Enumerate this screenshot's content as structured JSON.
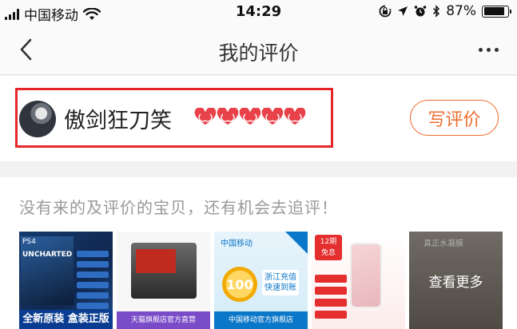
{
  "status_bar": {
    "carrier": "中国移动",
    "time": "14:29",
    "battery_percent": "87%",
    "battery_level": 0.87,
    "icons": [
      "signal-icon",
      "wifi-icon",
      "screen-lock-icon",
      "location-icon",
      "alarm-icon",
      "bluetooth-icon",
      "battery-icon"
    ]
  },
  "nav": {
    "title": "我的评价",
    "back_icon": "chevron-left-icon",
    "more_icon": "more-dots-icon"
  },
  "profile": {
    "username": "傲剑狂刀笑",
    "level_icons": "heart-icon",
    "level_count": 5,
    "write_button": "写评价"
  },
  "unrated": {
    "prompt": "没有来的及评价的宝贝，还有机会去追评！",
    "products": [
      {
        "name": "ps4-game-product",
        "band_text": "全新原装 盒装正版",
        "platform_text": "PS4",
        "game_text": "UNCHARTED"
      },
      {
        "name": "lego-truck-product",
        "band_text": "天猫旗舰店官方直营"
      },
      {
        "name": "phone-recharge-product",
        "brand_text": "中国移动",
        "amount_text": "100",
        "promo_line1": "浙江充值",
        "promo_line2": "快速到账",
        "band_text": "中国移动官方旗舰店"
      },
      {
        "name": "iphone-product",
        "tag_line1": "12期",
        "tag_line2": "免息"
      },
      {
        "name": "concrete-product",
        "title_text": "真正水凝膜",
        "overlay_text": "查看更多"
      }
    ]
  },
  "colors": {
    "accent": "#ef6c2e",
    "highlight": "#e5262b",
    "heart": "#e8414a"
  }
}
